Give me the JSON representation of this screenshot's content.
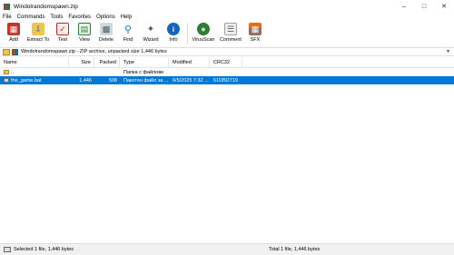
{
  "window": {
    "title": "Windolrandomspawn.zip"
  },
  "menu": [
    "File",
    "Commands",
    "Tools",
    "Favorites",
    "Options",
    "Help"
  ],
  "toolbar": [
    {
      "label": "Add",
      "icon": "add-archive-icon",
      "color": "#c0392b"
    },
    {
      "label": "Extract To",
      "icon": "extract-folder-icon",
      "color": "#1565c0"
    },
    {
      "label": "Test",
      "icon": "test-checklist-icon",
      "color": "#c62828"
    },
    {
      "label": "View",
      "icon": "view-book-icon",
      "color": "#2e7d32"
    },
    {
      "label": "Delete",
      "icon": "trash-icon",
      "color": "#607d8b"
    },
    {
      "label": "Find",
      "icon": "magnifier-icon",
      "color": "#1976d2"
    },
    {
      "label": "Wizard",
      "icon": "wand-icon",
      "color": "#6d4c41"
    },
    {
      "label": "Info",
      "icon": "info-icon",
      "color": "#1565c0"
    },
    {
      "label": "VirusScan",
      "icon": "shield-scan-icon",
      "color": "#2e7d32"
    },
    {
      "label": "Comment",
      "icon": "comment-icon",
      "color": "#757575"
    },
    {
      "label": "SFX",
      "icon": "sfx-box-icon",
      "color": "#ef6c00"
    }
  ],
  "pathbar": {
    "text": "Windolrandomspawn.zip - ZIP archive, unpacked size 1,446 bytes"
  },
  "columns": {
    "name": "Name",
    "size": "Size",
    "packed": "Packed",
    "type": "Type",
    "modified": "Modified",
    "crc": "CRC32"
  },
  "rows": [
    {
      "name": "..",
      "size": "",
      "packed": "",
      "type": "Папка с файлове",
      "modified": "",
      "crc": ""
    },
    {
      "name": "the_game.bat",
      "size": "1,446",
      "packed": "508",
      "type": "Пакетен файл за ...",
      "modified": "6/5/2025 7:32 ...",
      "crc": "61DBD719"
    }
  ],
  "status": {
    "left": "Selected 1 file, 1,446 bytes",
    "right": "Total 1 file, 1,446 bytes"
  }
}
